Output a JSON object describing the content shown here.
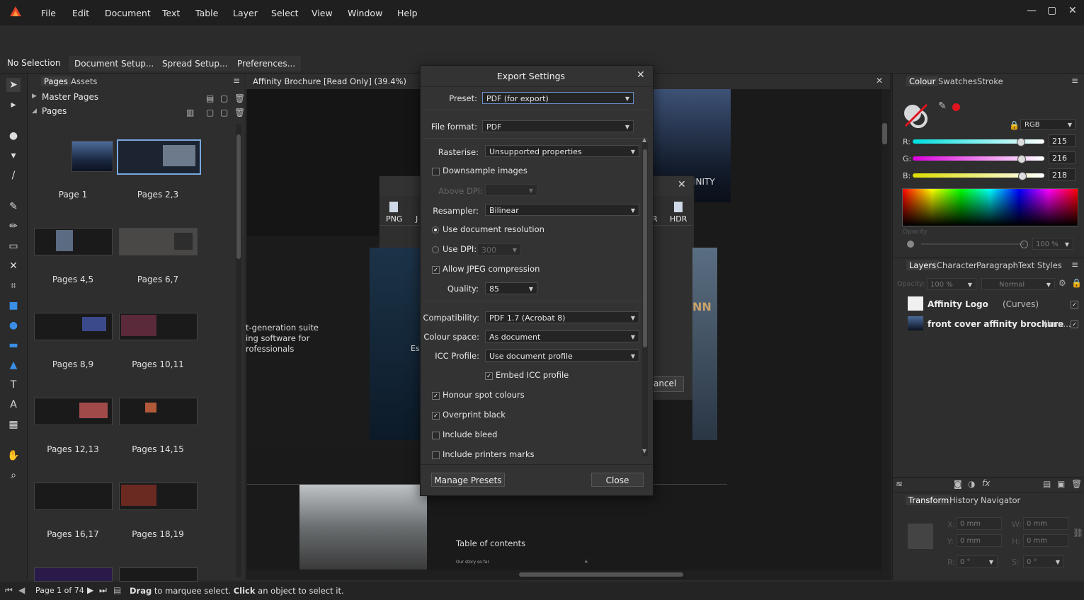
{
  "menu": [
    "File",
    "Edit",
    "Document",
    "Text",
    "Table",
    "Layer",
    "Select",
    "View",
    "Window",
    "Help"
  ],
  "window_controls": {
    "minimize": "—",
    "maximize": "▢",
    "close": "✕"
  },
  "context_bar": {
    "selection": "No Selection",
    "document_setup": "Document Setup...",
    "spread_setup": "Spread Setup...",
    "preferences": "Preferences..."
  },
  "pages_panel": {
    "tabs": [
      "Pages",
      "Assets"
    ],
    "master_pages": "Master Pages",
    "pages": "Pages",
    "thumbnails": [
      "Page 1",
      "Pages 2,3",
      "Pages 4,5",
      "Pages 6,7",
      "Pages 8,9",
      "Pages 10,11",
      "Pages 12,13",
      "Pages 14,15",
      "Pages 16,17",
      "Pages 18,19"
    ]
  },
  "document": {
    "tab_title": "Affinity Brochure [Read Only] (39.4%)",
    "canvas_text": {
      "suite_line1": "t-generation suite",
      "suite_line2": "ing software for",
      "suite_line3": "rofessionals",
      "toc": "Table of contents",
      "toc_item": "Our story so far",
      "toc_page": "6",
      "inity": "INITY",
      "nn": "NN",
      "est": "Est",
      "cancel": "ancel"
    },
    "format_icons": {
      "png": "PNG",
      "hdr": "HDR",
      "r": "R",
      "j": "J"
    }
  },
  "export_dialog": {
    "title": "Export Settings",
    "preset_label": "Preset:",
    "preset_value": "PDF (for export)",
    "file_format_label": "File format:",
    "file_format_value": "PDF",
    "rasterise_label": "Rasterise:",
    "rasterise_value": "Unsupported properties",
    "downsample": "Downsample images",
    "above_dpi_label": "Above DPI:",
    "resampler_label": "Resampler:",
    "resampler_value": "Bilinear",
    "use_doc_res": "Use document resolution",
    "use_dpi": "Use DPI:",
    "dpi_value": "300",
    "allow_jpeg": "Allow JPEG compression",
    "quality_label": "Quality:",
    "quality_value": "85",
    "compat_label": "Compatibility:",
    "compat_value": "PDF 1.7 (Acrobat 8)",
    "colour_space_label": "Colour space:",
    "colour_space_value": "As document",
    "icc_label": "ICC Profile:",
    "icc_value": "Use document profile",
    "embed_icc": "Embed ICC profile",
    "honour_spot": "Honour spot colours",
    "overprint": "Overprint black",
    "bleed": "Include bleed",
    "printers_marks": "Include printers marks",
    "manage_presets": "Manage Presets",
    "close": "Close",
    "checked": {
      "downsample": false,
      "allow_jpeg": true,
      "embed_icc": true,
      "honour_spot": true,
      "overprint": true,
      "bleed": false,
      "printers_marks": false
    }
  },
  "colour_panel": {
    "tabs": [
      "Colour",
      "Swatches",
      "Stroke"
    ],
    "model": "RGB",
    "r_label": "R:",
    "g_label": "G:",
    "b_label": "B:",
    "r": "215",
    "g": "216",
    "b": "218",
    "opacity_label": "Opacity",
    "opacity": "100 %",
    "accent_red": "#e0141e"
  },
  "layers_panel": {
    "tabs": [
      "Layers",
      "Character",
      "Paragraph",
      "Text Styles"
    ],
    "opacity_label": "Opacity:",
    "opacity": "100 %",
    "blend": "Normal",
    "layers": [
      {
        "name": "Affinity Logo",
        "type": "(Curves)"
      },
      {
        "name": "front cover affinity brochure",
        "type": "(Ima..."
      }
    ]
  },
  "transform_panel": {
    "tabs": [
      "Transform",
      "History",
      "Navigator"
    ],
    "x_label": "X:",
    "y_label": "Y:",
    "w_label": "W:",
    "h_label": "H:",
    "r_label": "R:",
    "s_label": "S:",
    "x": "0 mm",
    "y": "0 mm",
    "w": "0 mm",
    "h": "0 mm",
    "r": "0 °",
    "s": "0 °"
  },
  "status": {
    "page": "Page 1 of 74",
    "drag": "Drag",
    "drag_rest": " to marquee select. ",
    "click": "Click",
    "click_rest": " an object to select it."
  }
}
